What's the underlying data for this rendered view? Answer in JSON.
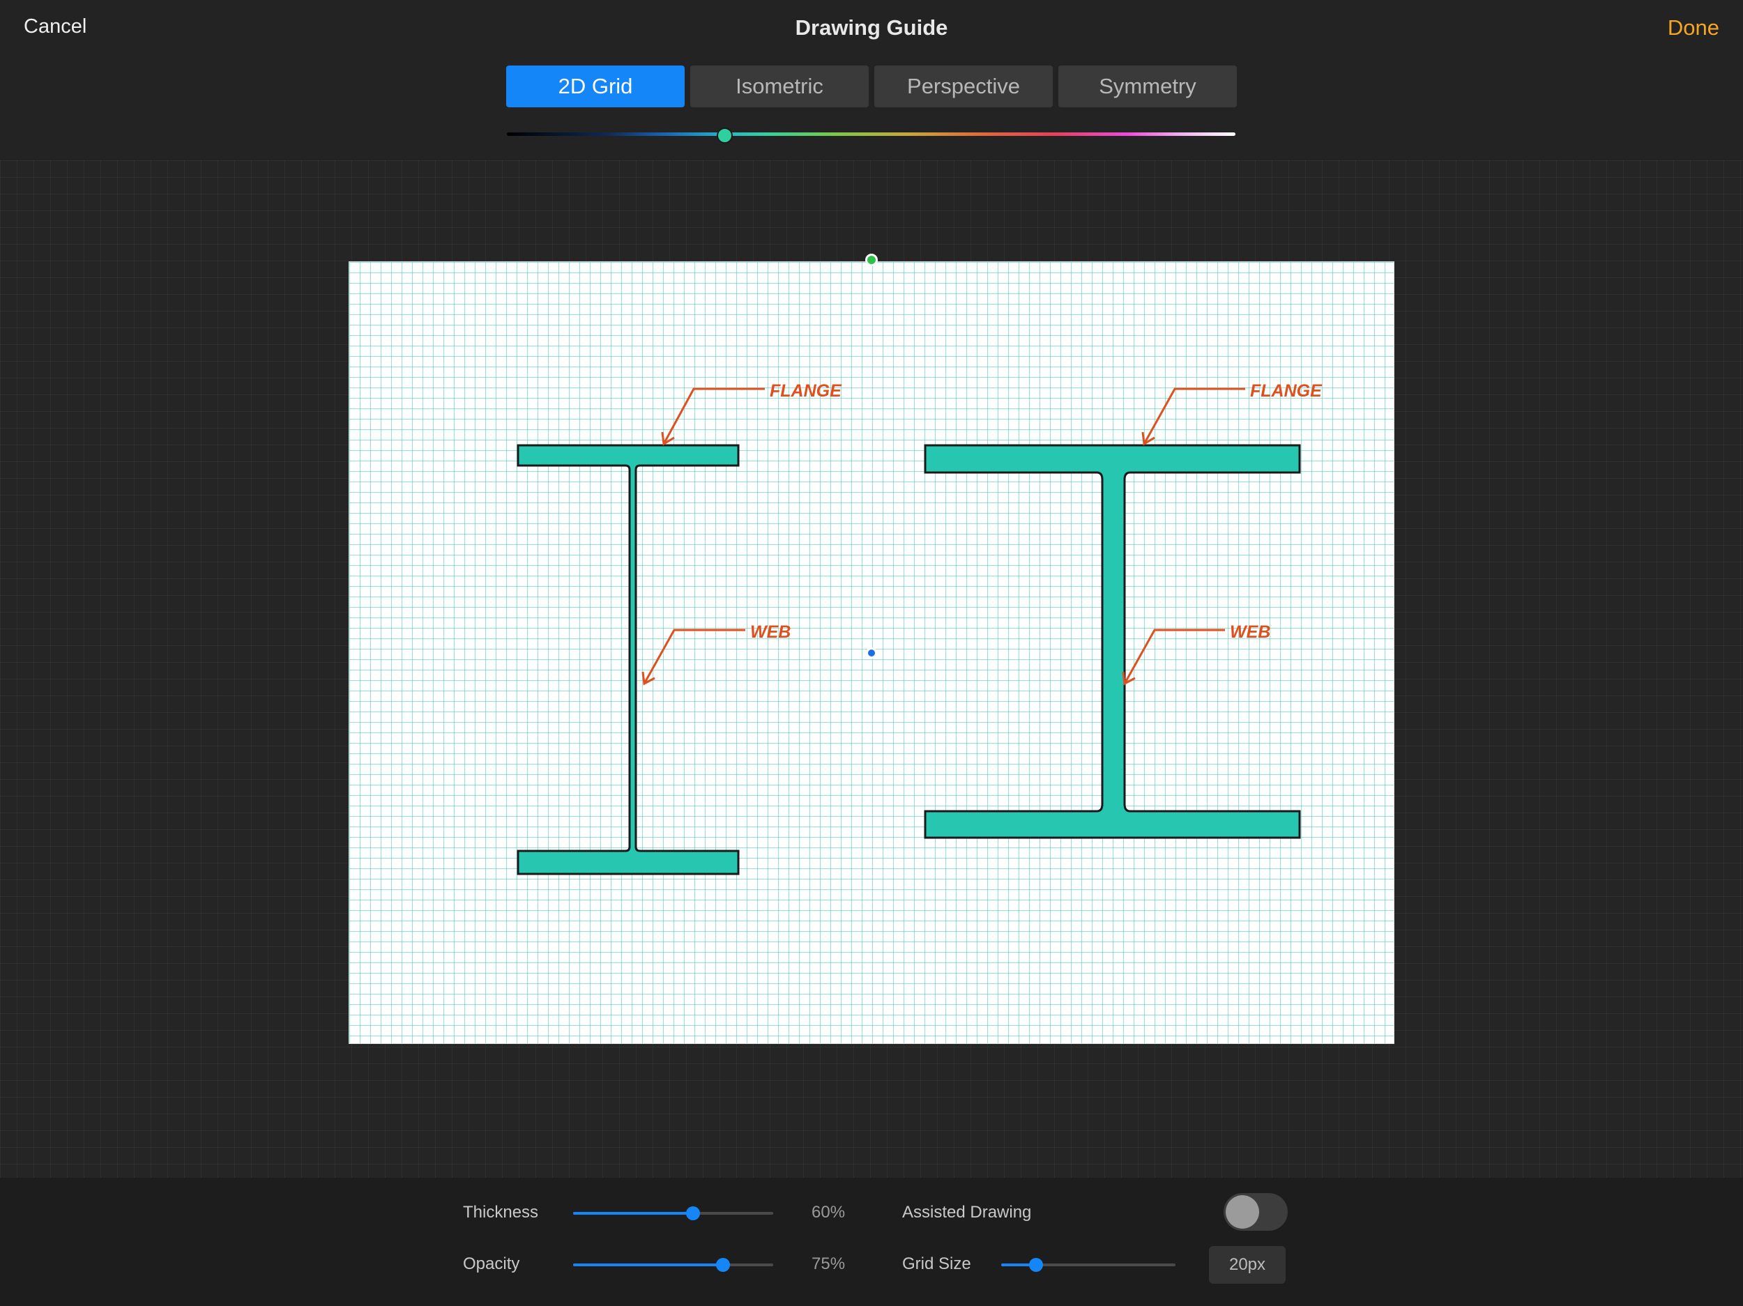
{
  "header": {
    "cancel_label": "Cancel",
    "title": "Drawing Guide",
    "done_label": "Done"
  },
  "tabs": [
    {
      "label": "2D Grid",
      "active": true
    },
    {
      "label": "Isometric",
      "active": false
    },
    {
      "label": "Perspective",
      "active": false
    },
    {
      "label": "Symmetry",
      "active": false
    }
  ],
  "guide_color": {
    "hue_position": 0.3,
    "knob_color": "#2fd0a0"
  },
  "canvas": {
    "annotations": {
      "left_flange": "FLANGE",
      "left_web": "WEB",
      "right_flange": "FLANGE",
      "right_web": "WEB"
    },
    "fill_color": "#26c6b0",
    "annotation_color": "#e0501e"
  },
  "settings": {
    "thickness": {
      "label": "Thickness",
      "value": "60%",
      "fraction": 0.6
    },
    "opacity": {
      "label": "Opacity",
      "value": "75%",
      "fraction": 0.75
    },
    "assisted_drawing": {
      "label": "Assisted Drawing",
      "enabled": false
    },
    "grid_size": {
      "label": "Grid Size",
      "value": "20px",
      "fraction": 0.2
    }
  }
}
